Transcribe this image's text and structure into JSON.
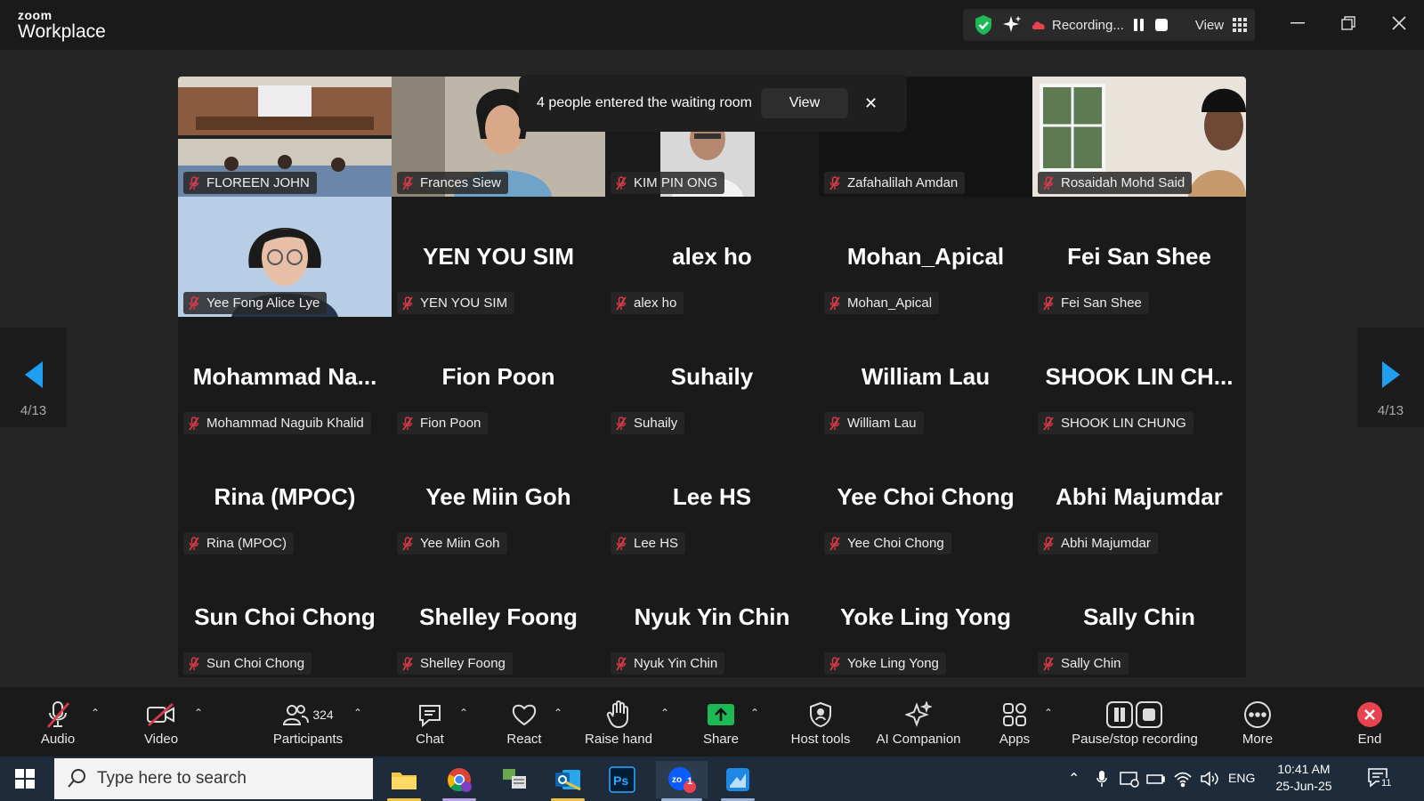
{
  "titlebar": {
    "brand_small": "zoom",
    "brand_big": "Workplace",
    "recording_label": "Recording...",
    "view_label": "View"
  },
  "toast": {
    "message": "4 people entered the waiting room",
    "view_button": "View",
    "close": "✕"
  },
  "pager": {
    "left_count": "4/13",
    "right_count": "4/13"
  },
  "participants": [
    {
      "label": "FLOREEN JOHN",
      "big": "",
      "video": "room"
    },
    {
      "label": "Frances Siew",
      "big": "",
      "video": "person"
    },
    {
      "label": "KIM PIN ONG",
      "big": "",
      "video": "car"
    },
    {
      "label": "Zafahalilah Amdan",
      "big": "",
      "video": "dark"
    },
    {
      "label": "Rosaidah Mohd Said",
      "big": "",
      "video": "window"
    },
    {
      "label": "Yee Fong Alice Lye",
      "big": "",
      "video": "woman"
    },
    {
      "label": "YEN YOU SIM",
      "big": "YEN YOU SIM"
    },
    {
      "label": "alex ho",
      "big": "alex ho"
    },
    {
      "label": "Mohan_Apical",
      "big": "Mohan_Apical"
    },
    {
      "label": "Fei San Shee",
      "big": "Fei San Shee"
    },
    {
      "label": "Mohammad Naguib Khalid",
      "big": "Mohammad  Na..."
    },
    {
      "label": "Fion Poon",
      "big": "Fion Poon"
    },
    {
      "label": "Suhaily",
      "big": "Suhaily"
    },
    {
      "label": "William Lau",
      "big": "William Lau"
    },
    {
      "label": "SHOOK LIN CHUNG",
      "big": "SHOOK  LIN  CH..."
    },
    {
      "label": "Rina (MPOC)",
      "big": "Rina (MPOC)"
    },
    {
      "label": "Yee Miin Goh",
      "big": "Yee Miin Goh"
    },
    {
      "label": "Lee HS",
      "big": "Lee HS"
    },
    {
      "label": "Yee Choi Chong",
      "big": "Yee Choi Chong"
    },
    {
      "label": "Abhi Majumdar",
      "big": "Abhi Majumdar"
    },
    {
      "label": "Sun Choi Chong",
      "big": "Sun Choi Chong"
    },
    {
      "label": "Shelley Foong",
      "big": "Shelley Foong"
    },
    {
      "label": "Nyuk Yin Chin",
      "big": "Nyuk Yin Chin"
    },
    {
      "label": "Yoke Ling Yong",
      "big": "Yoke Ling Yong"
    },
    {
      "label": "Sally Chin",
      "big": "Sally Chin"
    }
  ],
  "toolbar": {
    "audio": "Audio",
    "video": "Video",
    "participants": "Participants",
    "participants_count": "324",
    "chat": "Chat",
    "react": "React",
    "raise_hand": "Raise hand",
    "share": "Share",
    "host_tools": "Host tools",
    "ai_companion": "AI Companion",
    "apps": "Apps",
    "pause_stop_recording": "Pause/stop recording",
    "more": "More",
    "end": "End"
  },
  "taskbar": {
    "search_placeholder": "Type here to search",
    "language": "ENG",
    "time": "10:41 AM",
    "date": "25-Jun-25",
    "notification_count": "11",
    "zoom_badge": "1"
  },
  "colors": {
    "accent_green": "#1db954",
    "mute_red": "#e0394a",
    "pager_blue": "#1e9ff2",
    "end_red": "#e8434f"
  }
}
